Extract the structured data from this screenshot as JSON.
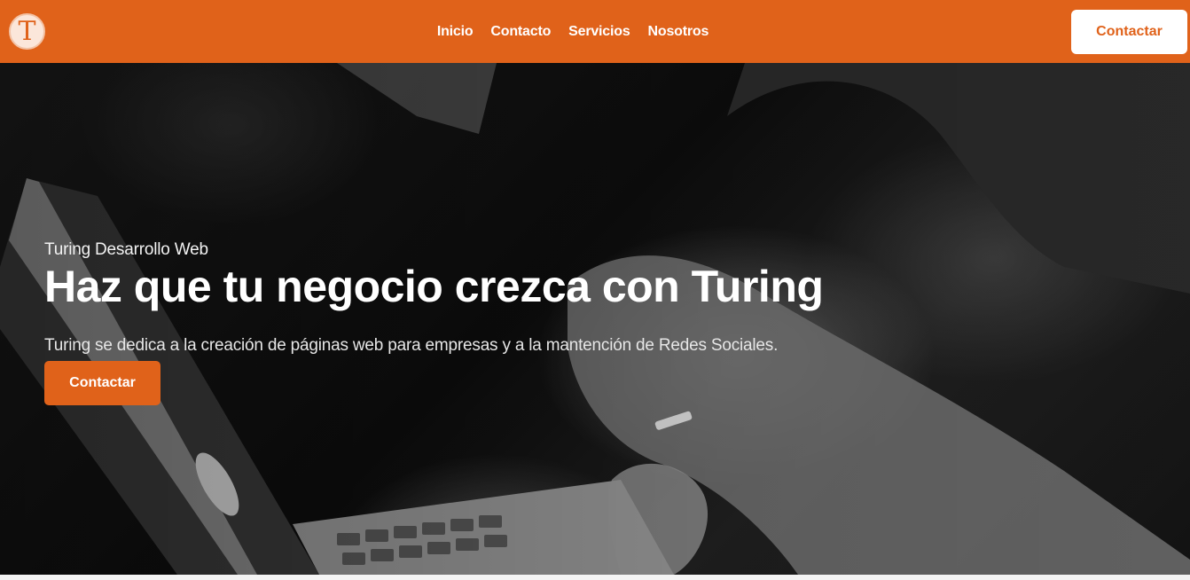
{
  "brand": {
    "logo_letter": "T",
    "accent_color": "#e0621a"
  },
  "nav": {
    "links": [
      {
        "label": "Inicio"
      },
      {
        "label": "Contacto"
      },
      {
        "label": "Servicios"
      },
      {
        "label": "Nosotros"
      }
    ],
    "cta_label": "Contactar"
  },
  "hero": {
    "eyebrow": "Turing Desarrollo Web",
    "title": "Haz que tu negocio crezca con Turing",
    "subtitle": "Turing se dedica a la creación de páginas web para empresas y a la mantención de Redes Sociales.",
    "cta_label": "Contactar",
    "background_icon": "laptop-hands-photo"
  }
}
